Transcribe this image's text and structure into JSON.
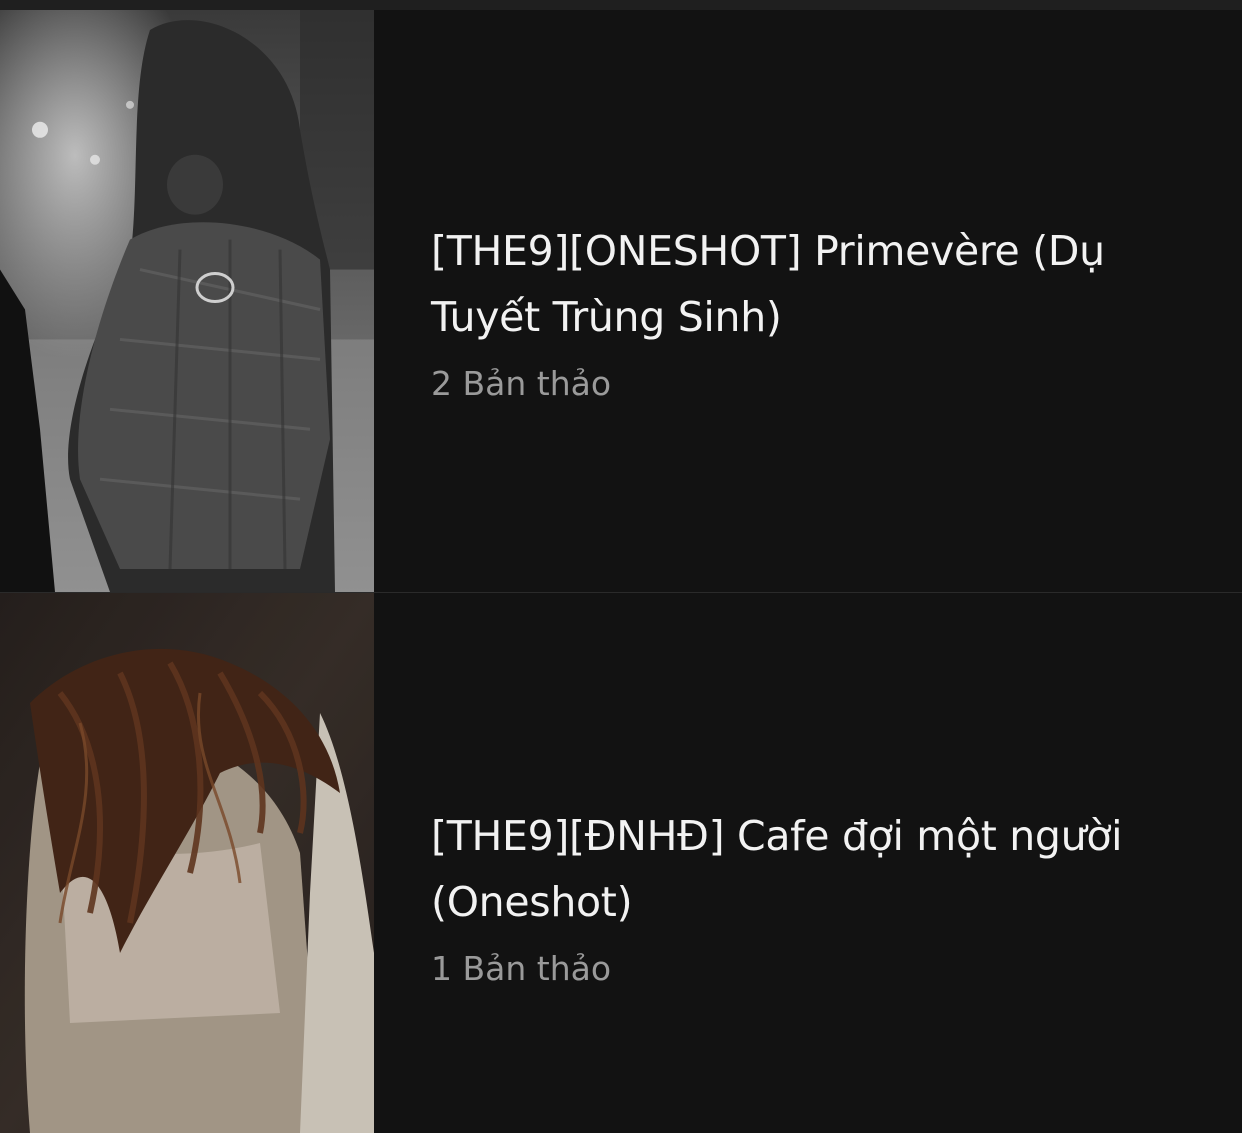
{
  "stories": [
    {
      "title": "[THE9][ONESHOT] Primevère (Dụ Tuyết Trùng Sinh)",
      "drafts": "2 Bản thảo",
      "cover_tone": "grayscale"
    },
    {
      "title": "[THE9][ĐNHĐ] Cafe đợi một người (Oneshot)",
      "drafts": "1 Bản thảo",
      "cover_tone": "warm-sepia"
    }
  ]
}
